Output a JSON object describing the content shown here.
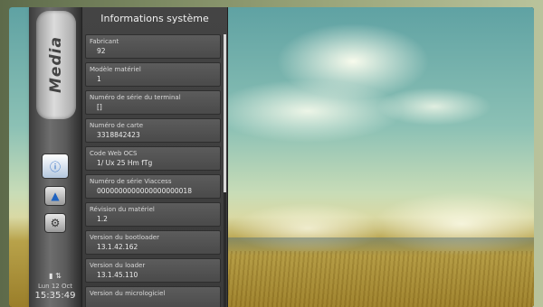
{
  "sidebar": {
    "tab_label": "Media",
    "icons": [
      "info-icon",
      "upload-icon",
      "settings-icon"
    ],
    "clock": {
      "date": "Lun 12 Oct",
      "time": "15:35:49"
    }
  },
  "panel": {
    "title": "Informations système",
    "items": [
      {
        "label": "Fabricant",
        "value": "92"
      },
      {
        "label": "Modèle matériel",
        "value": "1"
      },
      {
        "label": "Numéro de série du terminal",
        "value": "[]"
      },
      {
        "label": "Numéro de carte",
        "value": "3318842423"
      },
      {
        "label": "Code Web OCS",
        "value": "1/ Ux 25 Hm fTg"
      },
      {
        "label": "Numéro de série Viaccess",
        "value": "0000000000000000000018"
      },
      {
        "label": "Révision du matériel",
        "value": "1.2"
      },
      {
        "label": "Version du bootloader",
        "value": "13.1.42.162"
      },
      {
        "label": "Version du loader",
        "value": "13.1.45.110"
      },
      {
        "label": "Version du micrologiciel",
        "value": ""
      }
    ]
  },
  "colors": {
    "panel_bg": "#3f3f3f",
    "item_bg": "#555555",
    "accent_blue": "#1f63c0"
  }
}
